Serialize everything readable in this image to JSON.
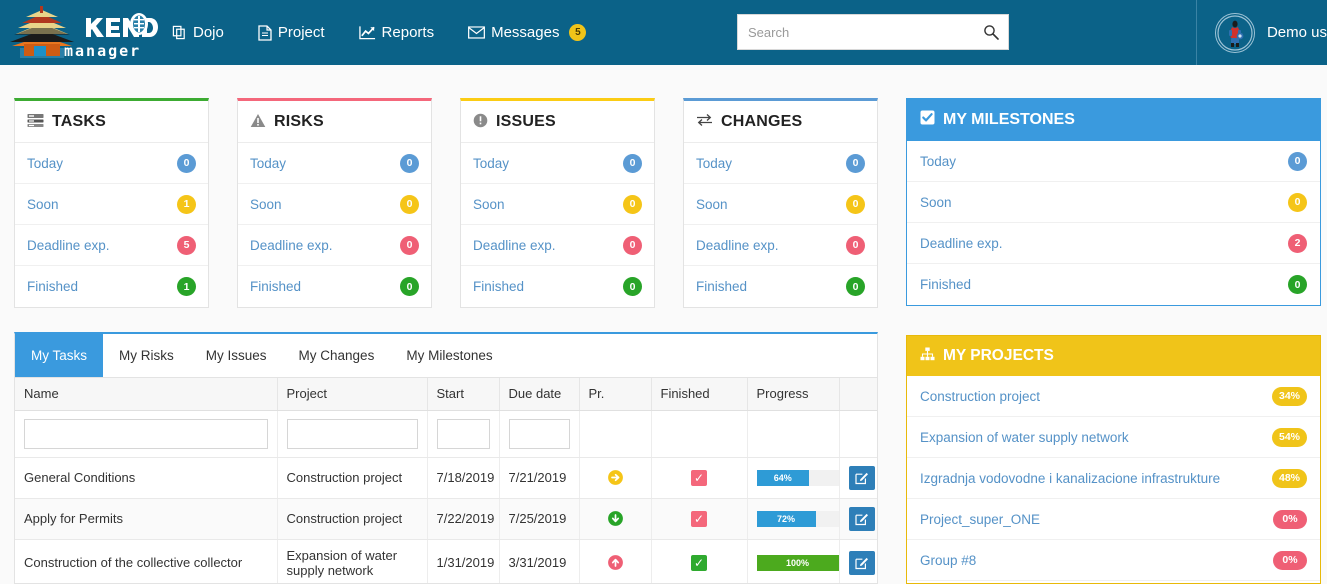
{
  "app": {
    "logo_text_top": "KENDO",
    "logo_text_bottom": "manager"
  },
  "nav": {
    "items": [
      {
        "label": "Dojo",
        "icon": "copy-icon"
      },
      {
        "label": "Project",
        "icon": "document-icon"
      },
      {
        "label": "Reports",
        "icon": "chart-line-icon"
      },
      {
        "label": "Messages",
        "icon": "envelope-icon",
        "badge": "5"
      }
    ]
  },
  "search": {
    "value": "",
    "placeholder": "Search",
    "icon": "search-icon"
  },
  "user": {
    "name": "Demo us",
    "avatar": "samurai-avatar"
  },
  "summary_cards": [
    {
      "title": "TASKS",
      "icon": "server-list-icon",
      "accent": "#3cab32",
      "accent_name": "green",
      "rows": [
        {
          "label": "Today",
          "count": "0",
          "color": "b"
        },
        {
          "label": "Soon",
          "count": "1",
          "color": "y"
        },
        {
          "label": "Deadline exp.",
          "count": "5",
          "color": "r"
        },
        {
          "label": "Finished",
          "count": "1",
          "color": "g"
        }
      ]
    },
    {
      "title": "RISKS",
      "icon": "warning-triangle-icon",
      "accent": "#f4677b",
      "accent_name": "red",
      "rows": [
        {
          "label": "Today",
          "count": "0",
          "color": "b"
        },
        {
          "label": "Soon",
          "count": "0",
          "color": "y"
        },
        {
          "label": "Deadline exp.",
          "count": "0",
          "color": "r"
        },
        {
          "label": "Finished",
          "count": "0",
          "color": "g"
        }
      ]
    },
    {
      "title": "ISSUES",
      "icon": "exclamation-circle-icon",
      "accent": "#fbcc14",
      "accent_name": "yellow",
      "rows": [
        {
          "label": "Today",
          "count": "0",
          "color": "b"
        },
        {
          "label": "Soon",
          "count": "0",
          "color": "y"
        },
        {
          "label": "Deadline exp.",
          "count": "0",
          "color": "r"
        },
        {
          "label": "Finished",
          "count": "0",
          "color": "g"
        }
      ]
    },
    {
      "title": "CHANGES",
      "icon": "exchange-arrows-icon",
      "accent": "#5b9bd5",
      "accent_name": "blue",
      "rows": [
        {
          "label": "Today",
          "count": "0",
          "color": "b"
        },
        {
          "label": "Soon",
          "count": "0",
          "color": "y"
        },
        {
          "label": "Deadline exp.",
          "count": "0",
          "color": "r"
        },
        {
          "label": "Finished",
          "count": "0",
          "color": "g"
        }
      ]
    }
  ],
  "milestones": {
    "title": "MY MILESTONES",
    "icon": "checkbox-checked-icon",
    "header_color": "#3a9ade",
    "rows": [
      {
        "label": "Today",
        "count": "0",
        "color": "b"
      },
      {
        "label": "Soon",
        "count": "0",
        "color": "y"
      },
      {
        "label": "Deadline exp.",
        "count": "2",
        "color": "r"
      },
      {
        "label": "Finished",
        "count": "0",
        "color": "g"
      }
    ]
  },
  "projects": {
    "title": "MY PROJECTS",
    "icon": "sitemap-icon",
    "header_color": "#f0c419",
    "rows": [
      {
        "label": "Construction project",
        "percent": "34%",
        "color": "y"
      },
      {
        "label": "Expansion of water supply network",
        "percent": "54%",
        "color": "y"
      },
      {
        "label": "Izgradnja vodovodne i kanalizacione infrastrukture",
        "percent": "48%",
        "color": "y"
      },
      {
        "label": "Project_super_ONE",
        "percent": "0%",
        "color": "r"
      },
      {
        "label": "Group #8",
        "percent": "0%",
        "color": "r"
      }
    ]
  },
  "main": {
    "tabs": [
      {
        "label": "My Tasks",
        "active": true
      },
      {
        "label": "My Risks",
        "active": false
      },
      {
        "label": "My Issues",
        "active": false
      },
      {
        "label": "My Changes",
        "active": false
      },
      {
        "label": "My Milestones",
        "active": false
      }
    ],
    "columns": [
      "Name",
      "Project",
      "Start",
      "Due date",
      "Pr.",
      "Finished",
      "Progress",
      ""
    ],
    "filters": {
      "name": "",
      "project": "",
      "start": "",
      "due_date": ""
    },
    "rows": [
      {
        "name": "General Conditions",
        "project": "Construction project",
        "start": "7/18/2019",
        "due_date": "7/21/2019",
        "priority": "medium-right-arrow",
        "priority_color": "#f5c518",
        "finished": false,
        "progress": "64%",
        "progress_value": 64,
        "progress_color": "blue",
        "edit_icon": "edit-pencil-icon"
      },
      {
        "name": "Apply for Permits",
        "project": "Construction project",
        "start": "7/22/2019",
        "due_date": "7/25/2019",
        "priority": "low-down-arrow",
        "priority_color": "#28a428",
        "finished": false,
        "progress": "72%",
        "progress_value": 72,
        "progress_color": "blue",
        "edit_icon": "edit-pencil-icon"
      },
      {
        "name": "Construction of the collective collector",
        "project": "Expansion of water supply network",
        "start": "1/31/2019",
        "due_date": "3/31/2019",
        "priority": "high-up-arrow",
        "priority_color": "#ef5f75",
        "finished": true,
        "progress": "100%",
        "progress_value": 100,
        "progress_color": "green",
        "edit_icon": "edit-pencil-icon"
      }
    ]
  }
}
